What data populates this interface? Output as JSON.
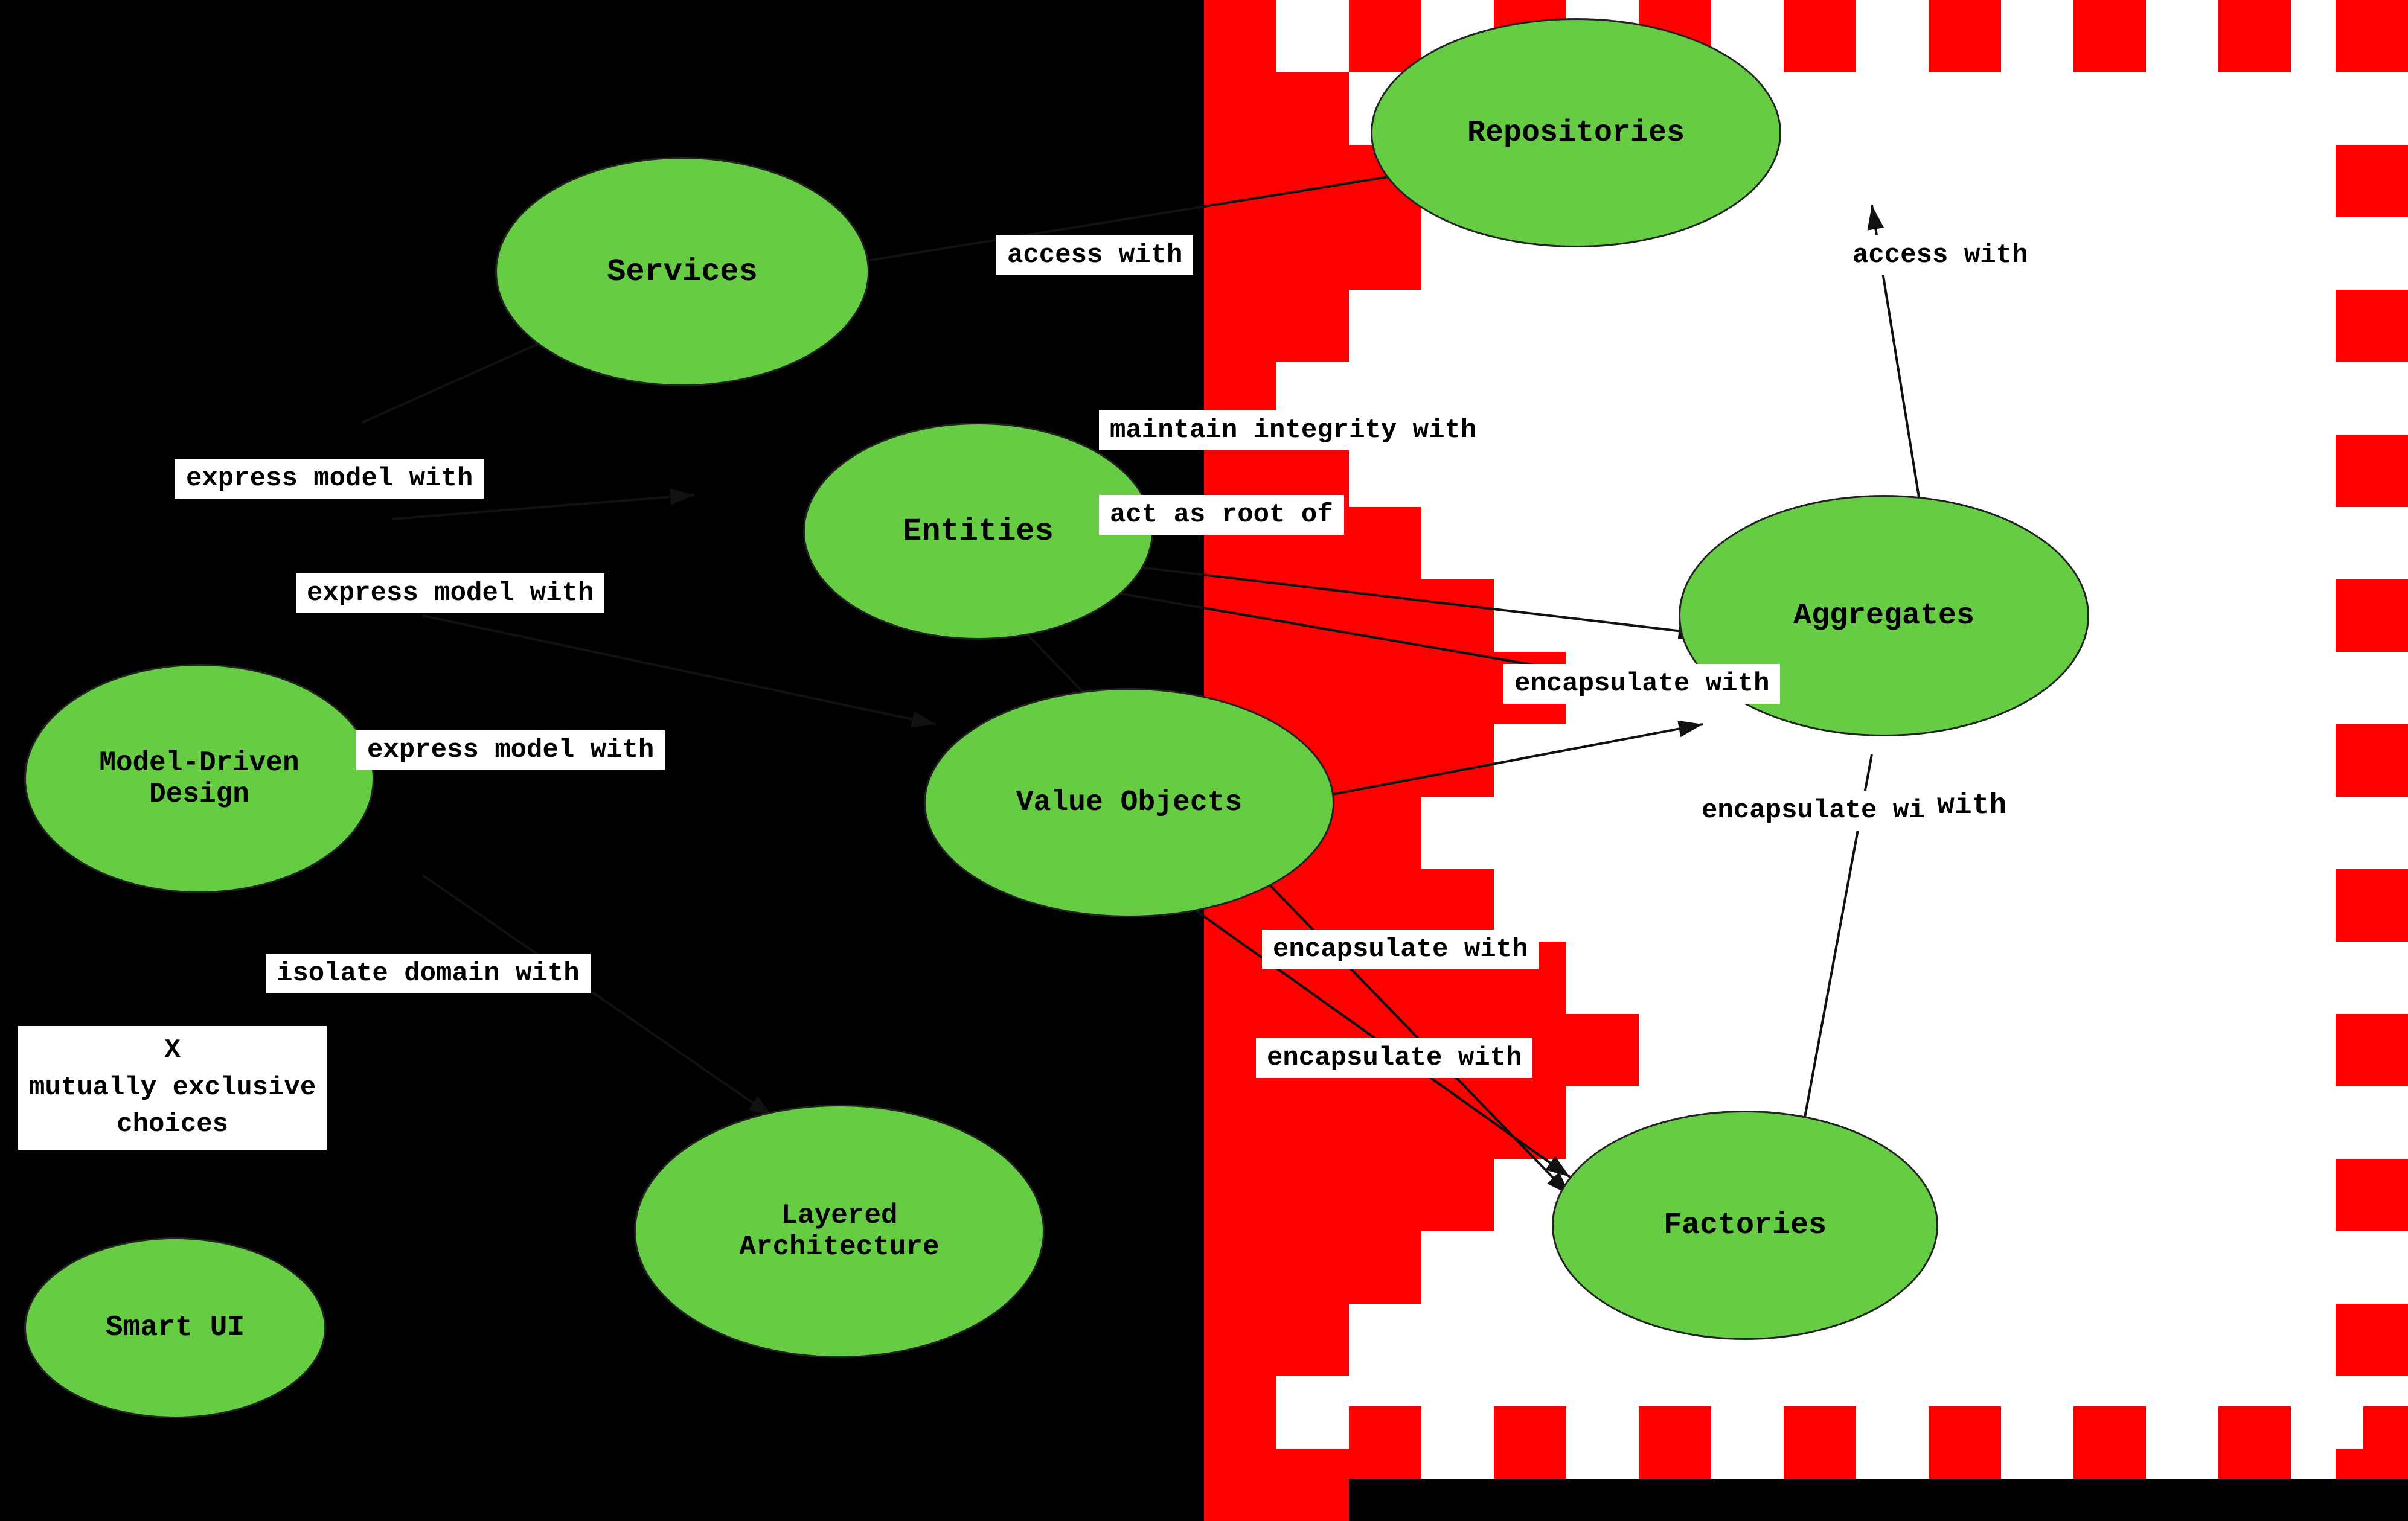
{
  "nodes": {
    "services": {
      "label": "Services"
    },
    "entities": {
      "label": "Entities"
    },
    "valueObjects": {
      "label": "Value Objects"
    },
    "modelDrivenDesign": {
      "label": "Model-Driven\nDesign"
    },
    "layeredArchitecture": {
      "label": "Layered\nArchitecture"
    },
    "smartUI": {
      "label": "Smart UI"
    },
    "repositories": {
      "label": "Repositories"
    },
    "aggregates": {
      "label": "Aggregates"
    },
    "factories": {
      "label": "Factories"
    }
  },
  "labels": {
    "expressModelWith1": "express model with",
    "expressModelWith2": "express model with",
    "expressModelWith3": "express model with",
    "accessWith1": "access with",
    "accessWith2": "access with",
    "maintainIntegrityWith": "maintain integrity with",
    "actAsRootOf": "act as root of",
    "encapsulateWith1": "encapsulate with",
    "encapsulateWith2": "encapsulate with",
    "encapsulateWith3": "encapsulate with",
    "encapsulateWith4": "encapsulate with",
    "isolateDomainWith": "isolate domain with",
    "xMutuallyExclusive": "X\nmutually exclusive\nchoices"
  },
  "colors": {
    "nodeGreen": "#66cc44",
    "nodeBorder": "#111",
    "red": "#dd0000",
    "white": "#ffffff",
    "black": "#000000"
  }
}
